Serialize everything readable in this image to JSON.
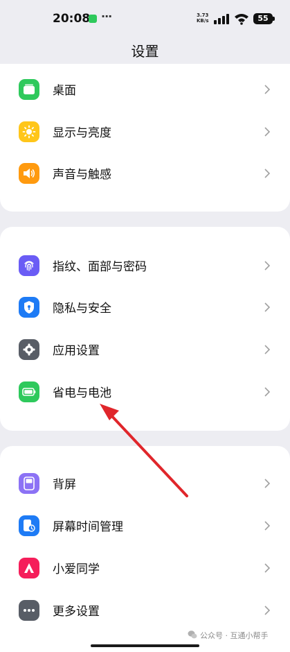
{
  "status_bar": {
    "time": "20:08",
    "net_speed_value": "3.73",
    "net_speed_unit": "KB/s",
    "battery": "55",
    "icons": [
      "app-notification-icon",
      "more-dots-icon",
      "signal-icon",
      "wifi-icon",
      "battery-icon"
    ]
  },
  "page": {
    "title": "设置"
  },
  "groups": [
    {
      "items": [
        {
          "label": "桌面",
          "icon": "desktop-icon",
          "color": "#2ec95c"
        },
        {
          "label": "显示与亮度",
          "icon": "sun-icon",
          "color": "#ffc61a"
        },
        {
          "label": "声音与触感",
          "icon": "speaker-icon",
          "color": "#ff9a0f"
        }
      ]
    },
    {
      "items": [
        {
          "label": "指纹、面部与密码",
          "icon": "fingerprint-icon",
          "color": "#6a5cf5"
        },
        {
          "label": "隐私与安全",
          "icon": "shield-icon",
          "color": "#1e7bf5"
        },
        {
          "label": "应用设置",
          "icon": "gear-icon",
          "color": "#585d66"
        },
        {
          "label": "省电与电池",
          "icon": "battery-icon",
          "color": "#2ec95c"
        }
      ]
    },
    {
      "items": [
        {
          "label": "背屏",
          "icon": "back-screen-icon",
          "color": "#8c72f5"
        },
        {
          "label": "屏幕时间管理",
          "icon": "screen-time-icon",
          "color": "#1e7bf5"
        },
        {
          "label": "小爱同学",
          "icon": "xiaoai-icon",
          "color": "#f51e5a"
        },
        {
          "label": "更多设置",
          "icon": "more-icon",
          "color": "#585d66"
        }
      ]
    }
  ],
  "watermark": "公众号 · 互通小帮手",
  "colors": {
    "background": "#ededf2",
    "card": "#ffffff",
    "annotation_arrow": "#e0262b"
  }
}
